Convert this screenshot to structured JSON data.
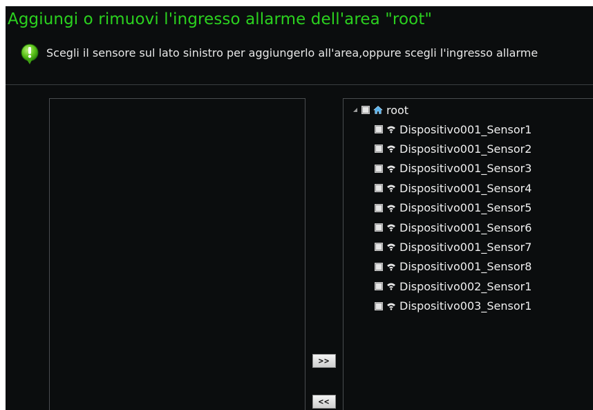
{
  "header": {
    "title": "Aggiungi o rimuovi l'ingresso allarme dell'area \"root\"",
    "hint": "Scegli il sensore sul lato sinistro per aggiungerlo all'area,oppure scegli l'ingresso allarme",
    "hint_icon": "info-bubble-icon"
  },
  "colors": {
    "title": "#2bd11f",
    "background": "#0b0d0e",
    "panel_border": "#4a4d50"
  },
  "left_panel": {
    "items": []
  },
  "transfer": {
    "add_label": ">>",
    "remove_label": "<<"
  },
  "tree": {
    "root": {
      "label": "root",
      "icon": "home-icon",
      "expanded": true
    },
    "sensors": [
      {
        "label": "Dispositivo001_Sensor1",
        "icon": "sensor-icon"
      },
      {
        "label": "Dispositivo001_Sensor2",
        "icon": "sensor-icon"
      },
      {
        "label": "Dispositivo001_Sensor3",
        "icon": "sensor-icon"
      },
      {
        "label": "Dispositivo001_Sensor4",
        "icon": "sensor-icon"
      },
      {
        "label": "Dispositivo001_Sensor5",
        "icon": "sensor-icon"
      },
      {
        "label": "Dispositivo001_Sensor6",
        "icon": "sensor-icon"
      },
      {
        "label": "Dispositivo001_Sensor7",
        "icon": "sensor-icon"
      },
      {
        "label": "Dispositivo001_Sensor8",
        "icon": "sensor-icon"
      },
      {
        "label": "Dispositivo002_Sensor1",
        "icon": "sensor-icon"
      },
      {
        "label": "Dispositivo003_Sensor1",
        "icon": "sensor-icon"
      }
    ]
  }
}
